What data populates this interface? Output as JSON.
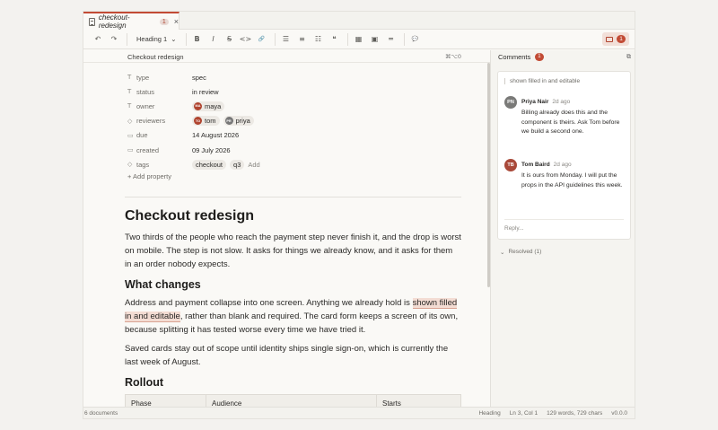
{
  "tab": {
    "title": "checkout-redesign",
    "badge": "1",
    "close": "×"
  },
  "toolbar": {
    "undo": "↶",
    "redo": "↷",
    "heading": "Heading 1",
    "heading_caret": "⌄",
    "bold": "B",
    "italic": "I",
    "strike": "S",
    "code": "<>",
    "link": "🔗",
    "bullet_list": "☰",
    "ordered_list": "≡",
    "task_list": "☷",
    "quote": "❝",
    "table": "▦",
    "image": "▣",
    "divider": "═",
    "comment": "💬",
    "comments_badge": "1"
  },
  "editor": {
    "doc_title": "Checkout redesign",
    "shortcut": "⌘⌥0",
    "properties": [
      {
        "icon": "T",
        "name": "type",
        "value": "spec"
      },
      {
        "icon": "T",
        "name": "status",
        "value": "in review"
      },
      {
        "icon": "T",
        "name": "owner",
        "people": [
          {
            "initials": "MA",
            "name": "maya"
          }
        ]
      },
      {
        "icon": "◇",
        "name": "reviewers",
        "people": [
          {
            "initials": "TO",
            "name": "tom"
          },
          {
            "initials": "PR",
            "name": "priya"
          }
        ]
      },
      {
        "icon": "▭",
        "name": "due",
        "value": "14 August 2026"
      },
      {
        "icon": "▭",
        "name": "created",
        "value": "09 July 2026"
      },
      {
        "icon": "◇",
        "name": "tags",
        "tags": [
          "checkout",
          "q3"
        ],
        "add": "Add"
      }
    ],
    "add_property": "+ Add property",
    "h1": "Checkout redesign",
    "p1": "Two thirds of the people who reach the payment step never finish it, and the drop is worst on mobile. The step is not slow. It asks for things we already know, and it asks for them in an order nobody expects.",
    "h2_changes": "What changes",
    "p2_before": "Address and payment collapse into one screen. Anything we already hold is ",
    "p2_highlight": "shown filled in and editable",
    "p2_after": ", rather than blank and required. The card form keeps a screen of its own, because splitting it has tested worse every time we have tried it.",
    "p3": "Saved cards stay out of scope until identity ships single sign-on, which is currently the last week of August.",
    "h2_rollout": "Rollout",
    "table_headers": [
      "Phase",
      "Audience",
      "Starts"
    ]
  },
  "comments": {
    "title": "Comments",
    "count": "1",
    "quote": "shown filled in and editable",
    "items": [
      {
        "initials": "PN",
        "author": "Priya Nair",
        "time": "2d ago",
        "text": "Billing already does this and the component is theirs. Ask Tom before we build a second one.",
        "color": "#7a7a78"
      },
      {
        "initials": "TB",
        "author": "Tom Baird",
        "time": "2d ago",
        "text": "It is ours from Monday. I will put the props in the API guidelines this week.",
        "color": "#a9493a"
      }
    ],
    "reply_placeholder": "Reply...",
    "resolved": "Resolved (1)"
  },
  "status": {
    "documents": "6 documents",
    "block": "Heading",
    "position": "Ln 3, Col 1",
    "counts": "129 words, 729 chars",
    "version": "v0.0.0"
  }
}
